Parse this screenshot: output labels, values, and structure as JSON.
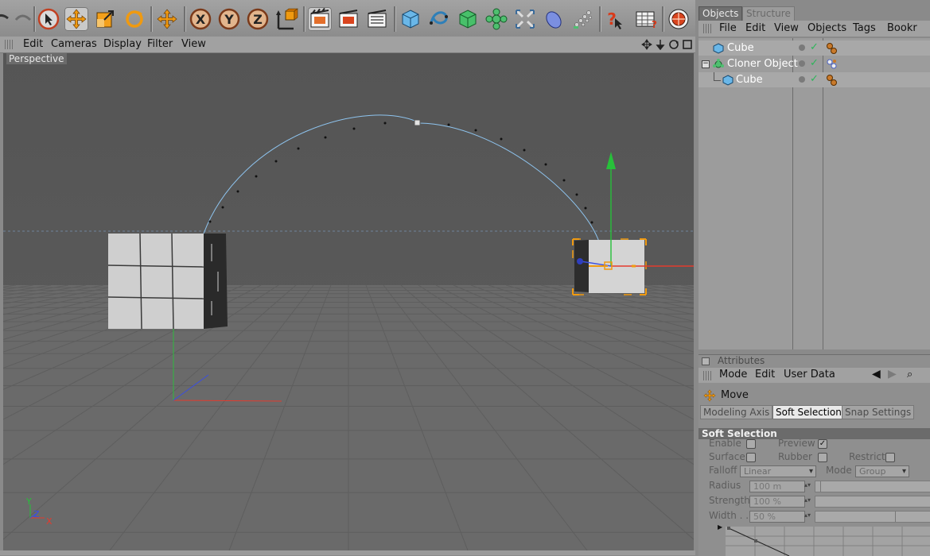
{
  "viewport": {
    "menu": [
      "Edit",
      "Cameras",
      "Display",
      "Filter",
      "View"
    ],
    "label": "Perspective",
    "gizmo_axes": {
      "y": "Y",
      "z": "Z",
      "x": "X"
    }
  },
  "objects_panel": {
    "tabs": [
      "Objects",
      "Structure"
    ],
    "menu": [
      "File",
      "Edit",
      "View",
      "Objects",
      "Tags",
      "Bookr"
    ],
    "items": [
      {
        "name": "Cube",
        "depth": 0,
        "icon": "cube-icon"
      },
      {
        "name": "Cloner Object",
        "depth": 0,
        "icon": "cloner-icon"
      },
      {
        "name": "Cube",
        "depth": 1,
        "icon": "cube-icon"
      }
    ]
  },
  "attributes_panel": {
    "title": "Attributes",
    "menu": [
      "Mode",
      "Edit",
      "User Data"
    ],
    "tool_name": "Move",
    "tabs": [
      "Modeling Axis",
      "Soft Selection",
      "Snap Settings"
    ],
    "active_tab": "Soft Selection",
    "section_title": "Soft Selection",
    "fields": {
      "enable": "Enable",
      "preview": "Preview",
      "surface": "Surface",
      "rubber": "Rubber",
      "restrict": "Restrict",
      "falloff_label": "Falloff",
      "falloff_value": "Linear",
      "mode_label": "Mode",
      "mode_value": "Group",
      "radius_label": "Radius",
      "radius_value": "100 m",
      "strength_label": "Strength",
      "strength_value": "100 %",
      "width_label": "Width . . .",
      "width_value": "50 %"
    },
    "checkbox_states": {
      "enable": false,
      "preview": true,
      "surface": false,
      "rubber": false,
      "restrict": false
    }
  },
  "colors": {
    "accent_orange": "#f09a10",
    "viewport_bg": "#595959",
    "spline": "#8ec4ef",
    "axis_x": "#e33b2e",
    "axis_y": "#27c03a",
    "axis_z": "#3a4ee0"
  }
}
